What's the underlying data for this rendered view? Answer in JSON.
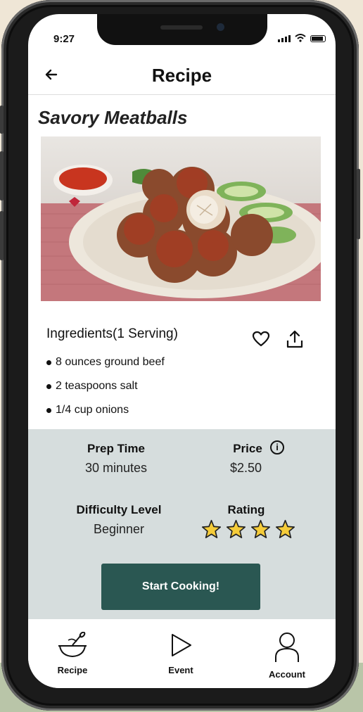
{
  "status_bar": {
    "time": "9:27"
  },
  "header": {
    "back_icon": "back-arrow-icon",
    "title": "Recipe"
  },
  "recipe": {
    "name": "Savory Meatballs",
    "ingredients_heading": "Ingredients(1 Serving)",
    "ingredients": [
      "8 ounces ground beef",
      "2 teaspoons salt",
      "1/4 cup onions"
    ]
  },
  "details": {
    "prep_time_label": "Prep Time",
    "prep_time_value": "30 minutes",
    "price_label": "Price",
    "price_value": "$2.50",
    "difficulty_label": "Difficulty Level",
    "difficulty_value": "Beginner",
    "rating_label": "Rating",
    "rating_stars": 4
  },
  "cta": {
    "label": "Start Cooking!"
  },
  "tabs": [
    {
      "label": "Recipe",
      "icon": "bowl-whisk-icon"
    },
    {
      "label": "Event",
      "icon": "play-triangle-icon"
    },
    {
      "label": "Account",
      "icon": "person-icon"
    }
  ],
  "colors": {
    "accent": "#2a5752",
    "info_panel": "#d6dddd",
    "star_fill": "#f5cc3a"
  }
}
